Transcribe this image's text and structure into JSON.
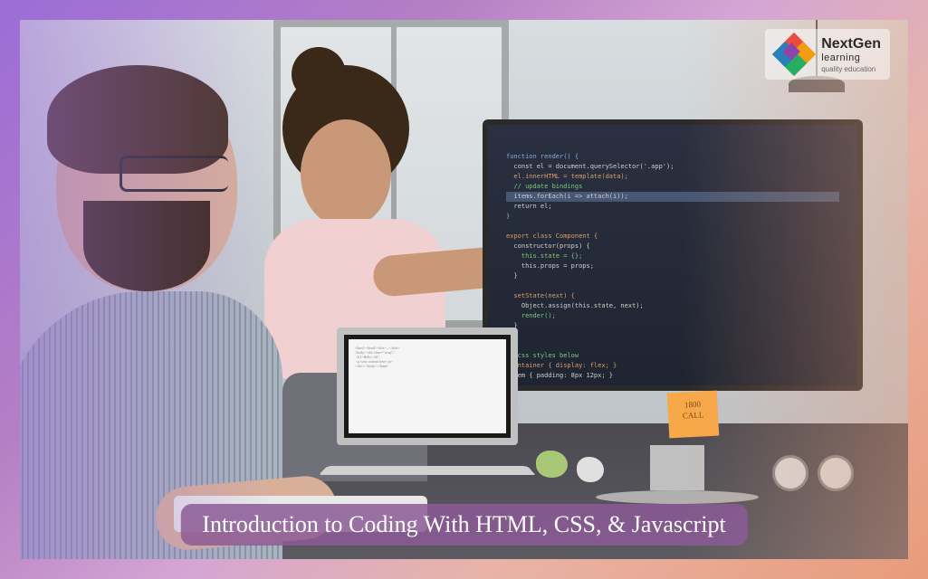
{
  "title": "Introduction to Coding With HTML, CSS, & Javascript",
  "logo": {
    "brand": "NextGen",
    "sub": "learning",
    "tagline": "quality education"
  },
  "sticky_note": {
    "line1": "1800",
    "line2": "CALL"
  },
  "colors": {
    "gradient_start": "#9b6dd7",
    "gradient_end": "#e89b7a",
    "banner_bg": "rgba(140,90,150,0.85)"
  }
}
